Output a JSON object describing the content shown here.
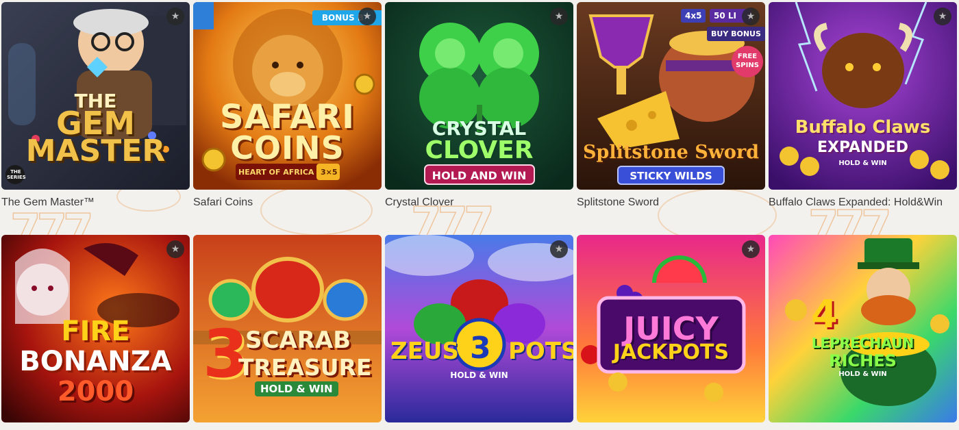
{
  "games": [
    {
      "name": "The Gem Master™",
      "art": {
        "line1": "THE",
        "line2": "GEM",
        "line3": "MASTER",
        "corner": "THE SERIES"
      }
    },
    {
      "name": "Safari Coins",
      "art": {
        "ribbon": "BONUS B",
        "line1": "SAFARI",
        "line2": "COINS",
        "tag": "HEART OF AFRICA",
        "tag2": "3×5"
      }
    },
    {
      "name": "Crystal Clover",
      "art": {
        "line1": "CRYSTAL",
        "line2": "CLOVER",
        "tag": "HOLD AND WIN"
      }
    },
    {
      "name": "Splitstone Sword",
      "art": {
        "badge1": "4x5",
        "badge2": "50 LI",
        "badge3": "BUY BONUS",
        "badge4": "FREE SPINS",
        "line1": "Splitstone Sword",
        "tag": "STICKY WILDS"
      }
    },
    {
      "name": "Buffalo Claws Expanded: Hold&Win",
      "art": {
        "line1": "Buffalo Claws",
        "line2": "EXPANDED",
        "tag": "HOLD & WIN"
      }
    },
    {
      "name": "",
      "art": {
        "line1": "FIRE",
        "line2": "BONANZA",
        "line3": "2000"
      }
    },
    {
      "name": "",
      "art": {
        "line1": "3",
        "line2": "SCARAB",
        "line3": "TREASURE",
        "tag": "HOLD & WIN"
      }
    },
    {
      "name": "",
      "art": {
        "line1": "ZEUS",
        "line2": "3",
        "line3": "POTS",
        "tag": "HOLD & WIN"
      }
    },
    {
      "name": "",
      "art": {
        "line1": "JUICY",
        "line2": "JACKPOTS"
      }
    },
    {
      "name": "",
      "art": {
        "line1": "4",
        "line2": "LEPRECHAUN",
        "line3": "RICHES",
        "tag": "HOLD & WIN"
      }
    }
  ],
  "favorite_icon": "star-icon",
  "colors": {
    "background": "#f3f1ee",
    "caption_text": "#3a3a3a",
    "favorite_bg": "#282828"
  }
}
